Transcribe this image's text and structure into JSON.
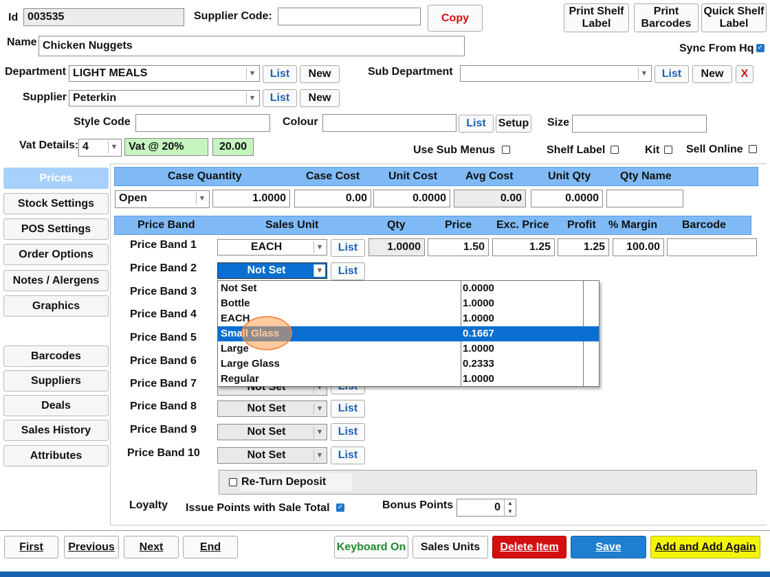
{
  "header": {
    "id_label": "Id",
    "id_value": "003535",
    "supplier_code_label": "Supplier Code:",
    "supplier_code_value": "",
    "copy_label": "Copy",
    "print_shelf_label_1": "Print Shelf",
    "print_shelf_label_2": "Label",
    "print_barcodes_1": "Print",
    "print_barcodes_2": "Barcodes",
    "quick_shelf_1": "Quick Shelf",
    "quick_shelf_2": "Label",
    "name_label": "Name",
    "name_value": "Chicken Nuggets",
    "sync_label": "Sync From Hq",
    "department_label": "Department",
    "department_value": "LIGHT MEALS",
    "list_label": "List",
    "new_label": "New",
    "sub_department_label": "Sub Department",
    "sub_department_value": "",
    "x_label": "X",
    "supplier_label": "Supplier",
    "supplier_value": "Peterkin",
    "style_code_label": "Style Code",
    "colour_label": "Colour",
    "setup_label": "Setup",
    "size_label": "Size",
    "vat_label": "Vat Details:",
    "vat_code": "4",
    "vat_name": "Vat @ 20%",
    "vat_rate": "20.00",
    "use_sub_menus_label": "Use Sub Menus",
    "shelf_label_label": "Shelf Label",
    "kit_label": "Kit",
    "sell_online_label": "Sell Online"
  },
  "sidebar": {
    "items": [
      {
        "label": "Prices"
      },
      {
        "label": "Stock Settings"
      },
      {
        "label": "POS Settings"
      },
      {
        "label": "Order Options"
      },
      {
        "label": "Notes / Alergens"
      },
      {
        "label": "Graphics"
      },
      {
        "label": "Barcodes"
      },
      {
        "label": "Suppliers"
      },
      {
        "label": "Deals"
      },
      {
        "label": "Sales History"
      },
      {
        "label": "Attributes"
      }
    ]
  },
  "case_table": {
    "headers": [
      "Case Quantity",
      "Case Cost",
      "Unit Cost",
      "Avg Cost",
      "Unit Qty",
      "Qty Name"
    ],
    "case_type": "Open",
    "case_quantity": "1.0000",
    "case_cost": "0.00",
    "unit_cost": "0.0000",
    "avg_cost": "0.00",
    "unit_qty": "0.0000",
    "qty_name": ""
  },
  "price_table": {
    "headers": [
      "Price Band",
      "Sales Unit",
      "Qty",
      "Price",
      "Exc. Price",
      "Profit",
      "% Margin",
      "Barcode"
    ],
    "bands": [
      {
        "label": "Price Band 1",
        "unit": "EACH",
        "qty": "1.0000",
        "price": "1.50",
        "exc": "1.25",
        "profit": "1.25",
        "margin": "100.00"
      },
      {
        "label": "Price Band 2",
        "unit": "Not Set"
      },
      {
        "label": "Price Band 3"
      },
      {
        "label": "Price Band 4"
      },
      {
        "label": "Price Band 5"
      },
      {
        "label": "Price Band 6"
      },
      {
        "label": "Price Band 7",
        "unit": "Not Set"
      },
      {
        "label": "Price Band 8",
        "unit": "Not Set"
      },
      {
        "label": "Price Band 9",
        "unit": "Not Set"
      },
      {
        "label": "Price Band 10",
        "unit": "Not Set"
      }
    ]
  },
  "dropdown": {
    "options": [
      {
        "name": "Not Set",
        "value": "0.0000"
      },
      {
        "name": "Bottle",
        "value": "1.0000"
      },
      {
        "name": "EACH",
        "value": "1.0000"
      },
      {
        "name": "Small Glass",
        "value": "0.1667"
      },
      {
        "name": "Large",
        "value": "1.0000"
      },
      {
        "name": "Large Glass",
        "value": "0.2333"
      },
      {
        "name": "Regular",
        "value": "1.0000"
      }
    ]
  },
  "deposit": {
    "label": "Re-Turn Deposit"
  },
  "loyalty": {
    "label": "Loyalty",
    "issue_points_label": "Issue Points with Sale Total",
    "bonus_points_label": "Bonus Points",
    "bonus_points_value": "0"
  },
  "footer": {
    "first": "First",
    "previous": "Previous",
    "next": "Next",
    "end": "End",
    "keyboard_on": "Keyboard On",
    "sales_units": "Sales Units",
    "delete_item": "Delete Item",
    "save": "Save",
    "add_again": "Add and Add Again"
  },
  "colors": {
    "header_blue": "#7fbaf6",
    "selection_blue": "#0a6fd1",
    "active_tab": "#a7d1fb",
    "delete_red": "#d40f0f",
    "save_blue": "#1e7fd0",
    "add_yellow": "#f4f40a",
    "keyboard_green": "#1e8b2e",
    "status_bar": "#1a63b0"
  }
}
